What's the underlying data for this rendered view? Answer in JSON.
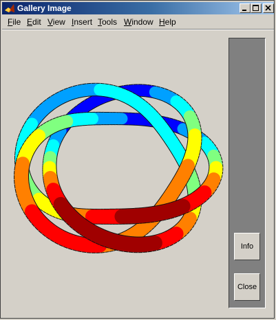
{
  "window": {
    "title": "Gallery Image",
    "controls": {
      "minimize": "minimize",
      "maximize": "maximize",
      "close": "close"
    }
  },
  "menu": {
    "items": [
      {
        "label": "File",
        "accel": "F"
      },
      {
        "label": "Edit",
        "accel": "E"
      },
      {
        "label": "View",
        "accel": "V"
      },
      {
        "label": "Insert",
        "accel": "I"
      },
      {
        "label": "Tools",
        "accel": "T"
      },
      {
        "label": "Window",
        "accel": "W"
      },
      {
        "label": "Help",
        "accel": "H"
      }
    ]
  },
  "panel": {
    "info_label": "Info",
    "close_label": "Close"
  },
  "figure": {
    "background": "#d4d0c8",
    "panel_color": "#808080",
    "colormap": [
      "#0000ff",
      "#00a0ff",
      "#00ffff",
      "#80ff80",
      "#ffff00",
      "#ff8000",
      "#ff0000",
      "#a00000"
    ]
  }
}
